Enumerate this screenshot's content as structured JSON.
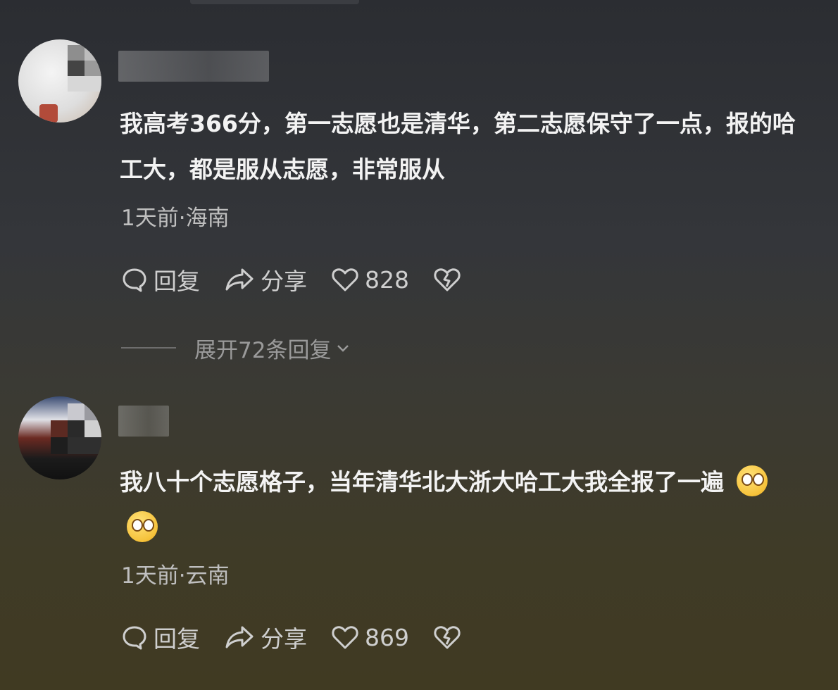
{
  "comments": [
    {
      "text": "我高考366分，第一志愿也是清华，第二志愿保守了一点，报的哈工大，都是服从志愿，非常服从",
      "meta": "1天前·海南",
      "actions": {
        "reply": "回复",
        "share": "分享",
        "likes": "828"
      },
      "expand_replies": "展开72条回复"
    },
    {
      "text": "我八十个志愿格子，当年清华北大浙大哈工大我全报了一遍",
      "emojis": [
        "eye-roll-emoji",
        "eye-roll-emoji"
      ],
      "meta": "1天前·云南",
      "actions": {
        "reply": "回复",
        "share": "分享",
        "likes": "869"
      }
    }
  ],
  "icons": [
    "comment-bubble-icon",
    "share-arrow-icon",
    "heart-icon",
    "broken-heart-icon",
    "chevron-down-icon"
  ]
}
